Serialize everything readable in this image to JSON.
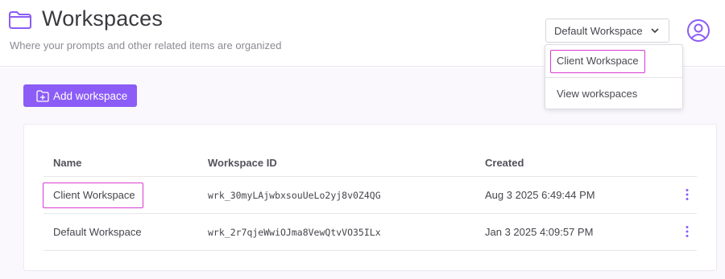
{
  "header": {
    "title": "Workspaces",
    "subtitle": "Where your prompts and other related items are organized",
    "workspace_select": {
      "value": "Default Workspace"
    },
    "dropdown": {
      "items": [
        {
          "label": "Client Workspace",
          "highlighted": true
        },
        {
          "label": "View workspaces"
        }
      ]
    }
  },
  "toolbar": {
    "add_label": "Add workspace"
  },
  "table": {
    "columns": [
      "Name",
      "Workspace ID",
      "Created"
    ],
    "rows": [
      {
        "name": "Client Workspace",
        "id": "wrk_30myLAjwbxsouUeLo2yj8v0Z4QG",
        "created": "Aug 3 2025 6:49:44 PM",
        "highlighted": true
      },
      {
        "name": "Default Workspace",
        "id": "wrk_2r7qjeWwiOJma8VewQtvVO35ILx",
        "created": "Jan 3 2025 4:09:57 PM"
      }
    ]
  },
  "colors": {
    "accent": "#8b5cf6",
    "highlight": "#d73cd0"
  },
  "icons": {
    "title": "folder-icon",
    "select": "chevron-down-icon",
    "avatar": "user-circle-icon",
    "add": "folder-plus-icon",
    "row_menu": "kebab-menu-icon"
  }
}
